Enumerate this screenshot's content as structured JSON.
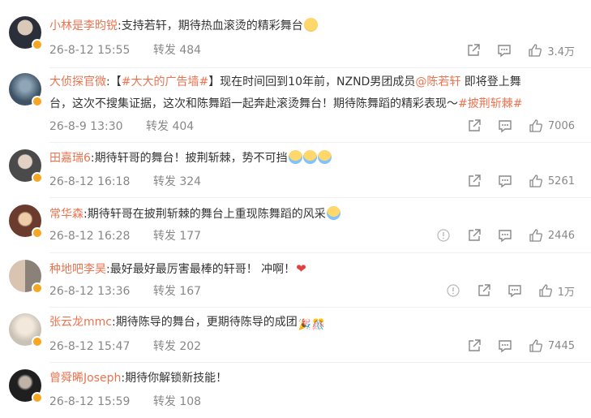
{
  "comments": [
    {
      "user": "小林是李昀锐",
      "text_parts": [
        ":支持若轩，期待热血滚烫的精彩舞台"
      ],
      "time": "26-8-12 15:55",
      "repost_label": "转发",
      "repost_count": "484",
      "likes": "3.4万",
      "has_report": false,
      "avatar_color": "#2b2f3a"
    },
    {
      "user": "大侦探官微",
      "line1_prefix": ":【",
      "topic1": "#大大的广告墙#",
      "line1_mid": "】现在时间回到10年前，NZND男团成员",
      "mention": "@陈若轩",
      "line1_suffix": " 即将登上舞",
      "line2": "台，这次不搜集证据，这次和陈舞蹈一起奔赴滚烫舞台！期待陈舞蹈的精彩表现～",
      "topic2": "#披荆斩棘#",
      "time": "26-8-9 13:30",
      "repost_label": "转发",
      "repost_count": "404",
      "likes": "7006",
      "has_report": false,
      "avatar_color": "#3e5366"
    },
    {
      "user": "田嘉瑞6",
      "text_parts": [
        ":期待轩哥的舞台！披荆斩棘，势不可挡"
      ],
      "time": "26-8-12 16:18",
      "repost_label": "转发",
      "repost_count": "324",
      "likes": "5261",
      "has_report": false,
      "avatar_color": "#4a4a4a"
    },
    {
      "user": "常华森",
      "text_parts": [
        ":期待轩哥在披荆斩棘的舞台上重现陈舞蹈的风采"
      ],
      "time": "26-8-12 16:28",
      "repost_label": "转发",
      "repost_count": "177",
      "likes": "2446",
      "has_report": true,
      "avatar_color": "#6b3b2e"
    },
    {
      "user": "种地吧李昊",
      "text_parts": [
        ":最好最好最厉害最棒的轩哥！ 冲啊！"
      ],
      "time": "26-8-12 13:36",
      "repost_label": "转发",
      "repost_count": "167",
      "likes": "1万",
      "has_report": true,
      "avatar_color": "#8a8178"
    },
    {
      "user": "张云龙mmc",
      "text_parts": [
        ":期待陈导的舞台，更期待陈导的成团"
      ],
      "time": "26-8-12 15:47",
      "repost_label": "转发",
      "repost_count": "202",
      "likes": "7445",
      "has_report": false,
      "avatar_color": "#c9c2b6"
    },
    {
      "user": "曾舜晞Joseph",
      "text_parts": [
        ":期待你解锁新技能！"
      ],
      "time": "26-8-12 15:59",
      "repost_label": "转发",
      "repost_count": "108",
      "likes": "",
      "has_report": false,
      "avatar_color": "#1f1f1f"
    }
  ],
  "icons": {
    "share": "share-icon",
    "comment": "comment-icon",
    "like": "thumbs-up-icon",
    "report": "report-icon"
  },
  "colors": {
    "username": "#eb7350",
    "meta": "#888888",
    "badge": "#f5a623",
    "heart": "#e0403f"
  }
}
